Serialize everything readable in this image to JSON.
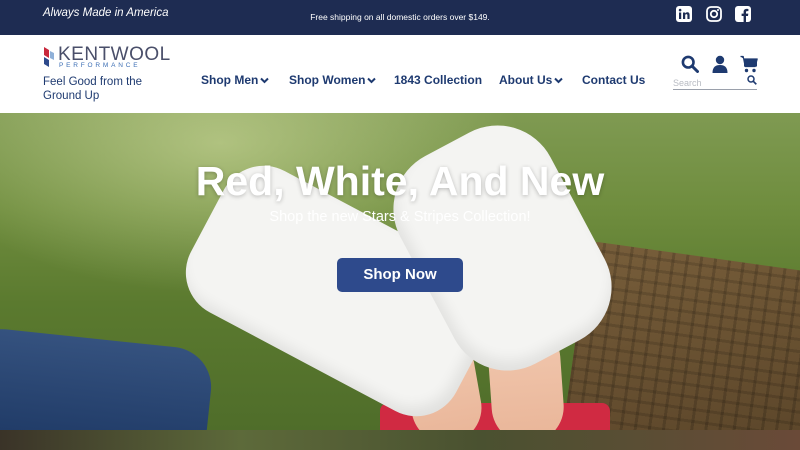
{
  "topbar": {
    "tagline": "Always Made in America",
    "shipping": "Free shipping on all domestic orders over $149.",
    "social": [
      "linkedin-icon",
      "instagram-icon",
      "facebook-icon"
    ]
  },
  "header": {
    "logo_word": "KENTWOOL",
    "logo_sub": "PERFORMANCE",
    "slogan": "Feel Good from the Ground Up",
    "nav": [
      {
        "label": "Shop Men",
        "dropdown": true
      },
      {
        "label": "Shop Women",
        "dropdown": true
      },
      {
        "label": "1843 Collection",
        "dropdown": false
      },
      {
        "label": "About Us",
        "dropdown": true
      },
      {
        "label": "Contact Us",
        "dropdown": false
      }
    ],
    "search_placeholder": "Search"
  },
  "hero": {
    "title": "Red, White, And New",
    "subtitle": "Shop the new Stars & Stripes Collection!",
    "button": "Shop Now"
  },
  "colors": {
    "topbar_bg": "#1e2c52",
    "brand_navy": "#1e3a70",
    "button_bg": "#2e4a8c"
  }
}
